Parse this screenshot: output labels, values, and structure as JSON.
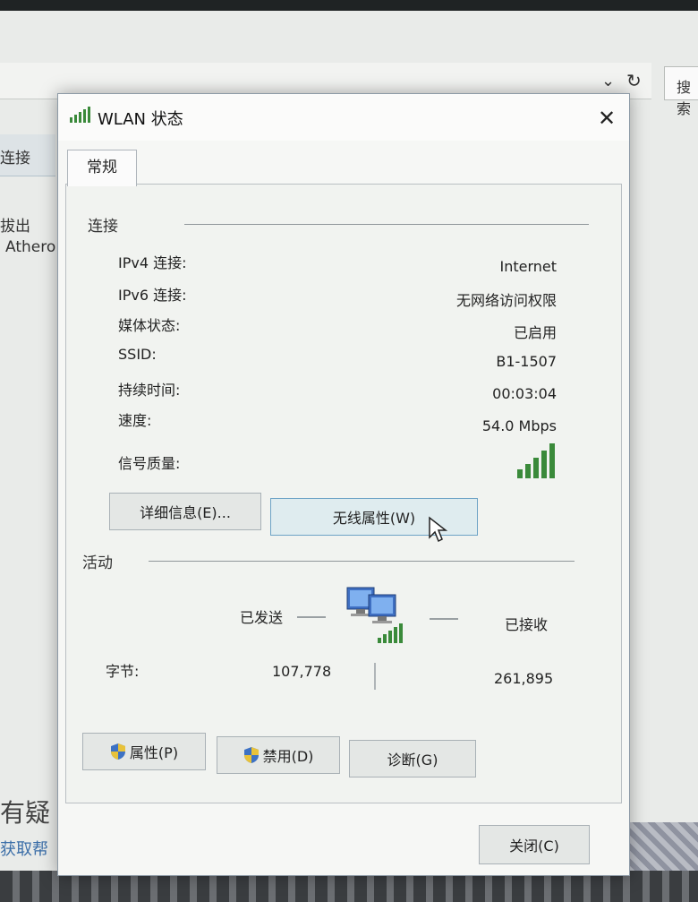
{
  "background_window": {
    "search_label": "搜索",
    "tab_label": "连接",
    "text_1": "拔出",
    "text_2": "Athero",
    "question_text": "有疑",
    "help_link": "获取帮"
  },
  "dialog": {
    "title": "WLAN 状态",
    "close_glyph": "✕",
    "tab": "常规",
    "connection": {
      "section_title": "连接",
      "rows": [
        {
          "label": "IPv4 连接:",
          "value": "Internet"
        },
        {
          "label": "IPv6 连接:",
          "value": "无网络访问权限"
        },
        {
          "label": "媒体状态:",
          "value": "已启用"
        },
        {
          "label": "SSID:",
          "value": "B1-1507"
        },
        {
          "label": "持续时间:",
          "value": "00:03:04"
        },
        {
          "label": "速度:",
          "value": "54.0 Mbps"
        }
      ],
      "signal_label": "信号质量:",
      "signal_bars": 5,
      "details_button": "详细信息(E)...",
      "wireless_props_button": "无线属性(W)"
    },
    "activity": {
      "section_title": "活动",
      "sent_label": "已发送",
      "received_label": "已接收",
      "bytes_label": "字节:",
      "bytes_sent": "107,778",
      "bytes_received": "261,895"
    },
    "actions": {
      "properties_button": "属性(P)",
      "disable_button": "禁用(D)",
      "diagnose_button": "诊断(G)",
      "close_button": "关闭(C)"
    }
  },
  "colors": {
    "signal_green": "#3a8a3a",
    "shield_blue": "#3d72c4",
    "shield_yellow": "#e8c23a",
    "focus_border": "#6ea3c6"
  }
}
